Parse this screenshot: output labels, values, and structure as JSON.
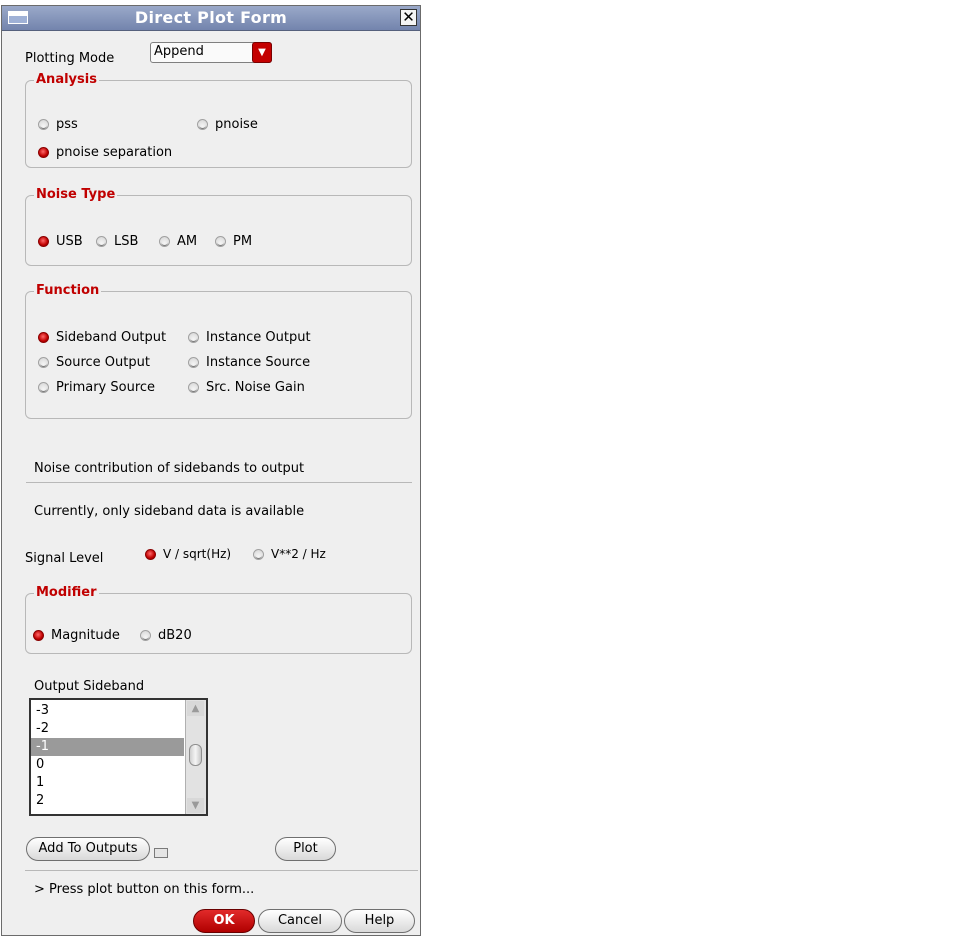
{
  "window": {
    "title": "Direct Plot Form"
  },
  "plotting_mode": {
    "label": "Plotting Mode",
    "value": "Append"
  },
  "analysis": {
    "legend": "Analysis",
    "options": [
      {
        "label": "pss",
        "selected": false
      },
      {
        "label": "pnoise",
        "selected": false
      },
      {
        "label": "pnoise separation",
        "selected": true
      }
    ]
  },
  "noise_type": {
    "legend": "Noise Type",
    "options": [
      {
        "label": "USB",
        "selected": true
      },
      {
        "label": "LSB",
        "selected": false
      },
      {
        "label": "AM",
        "selected": false
      },
      {
        "label": "PM",
        "selected": false
      }
    ]
  },
  "function": {
    "legend": "Function",
    "options": [
      {
        "label": "Sideband Output",
        "selected": true
      },
      {
        "label": "Instance Output",
        "selected": false
      },
      {
        "label": "Source Output",
        "selected": false
      },
      {
        "label": "Instance Source",
        "selected": false
      },
      {
        "label": "Primary Source",
        "selected": false
      },
      {
        "label": "Src. Noise Gain",
        "selected": false
      }
    ]
  },
  "description": "Noise contribution of sidebands to output",
  "availability_note": "Currently, only sideband data is available",
  "signal_level": {
    "label": "Signal Level",
    "options": [
      {
        "label": "V / sqrt(Hz)",
        "selected": true
      },
      {
        "label": "V**2 / Hz",
        "selected": false
      }
    ]
  },
  "modifier": {
    "legend": "Modifier",
    "options": [
      {
        "label": "Magnitude",
        "selected": true
      },
      {
        "label": "dB20",
        "selected": false
      }
    ]
  },
  "output_sideband": {
    "label": "Output Sideband",
    "items": [
      "-3",
      "-2",
      "-1",
      "0",
      "1",
      "2"
    ],
    "selected": "-1"
  },
  "buttons": {
    "add_to_outputs": "Add To Outputs",
    "plot": "Plot",
    "ok": "OK",
    "cancel": "Cancel",
    "help": "Help"
  },
  "status_message": "> Press plot button on this form...",
  "colors": {
    "accent": "#c00000",
    "title_bar": "#7f8fb5"
  }
}
